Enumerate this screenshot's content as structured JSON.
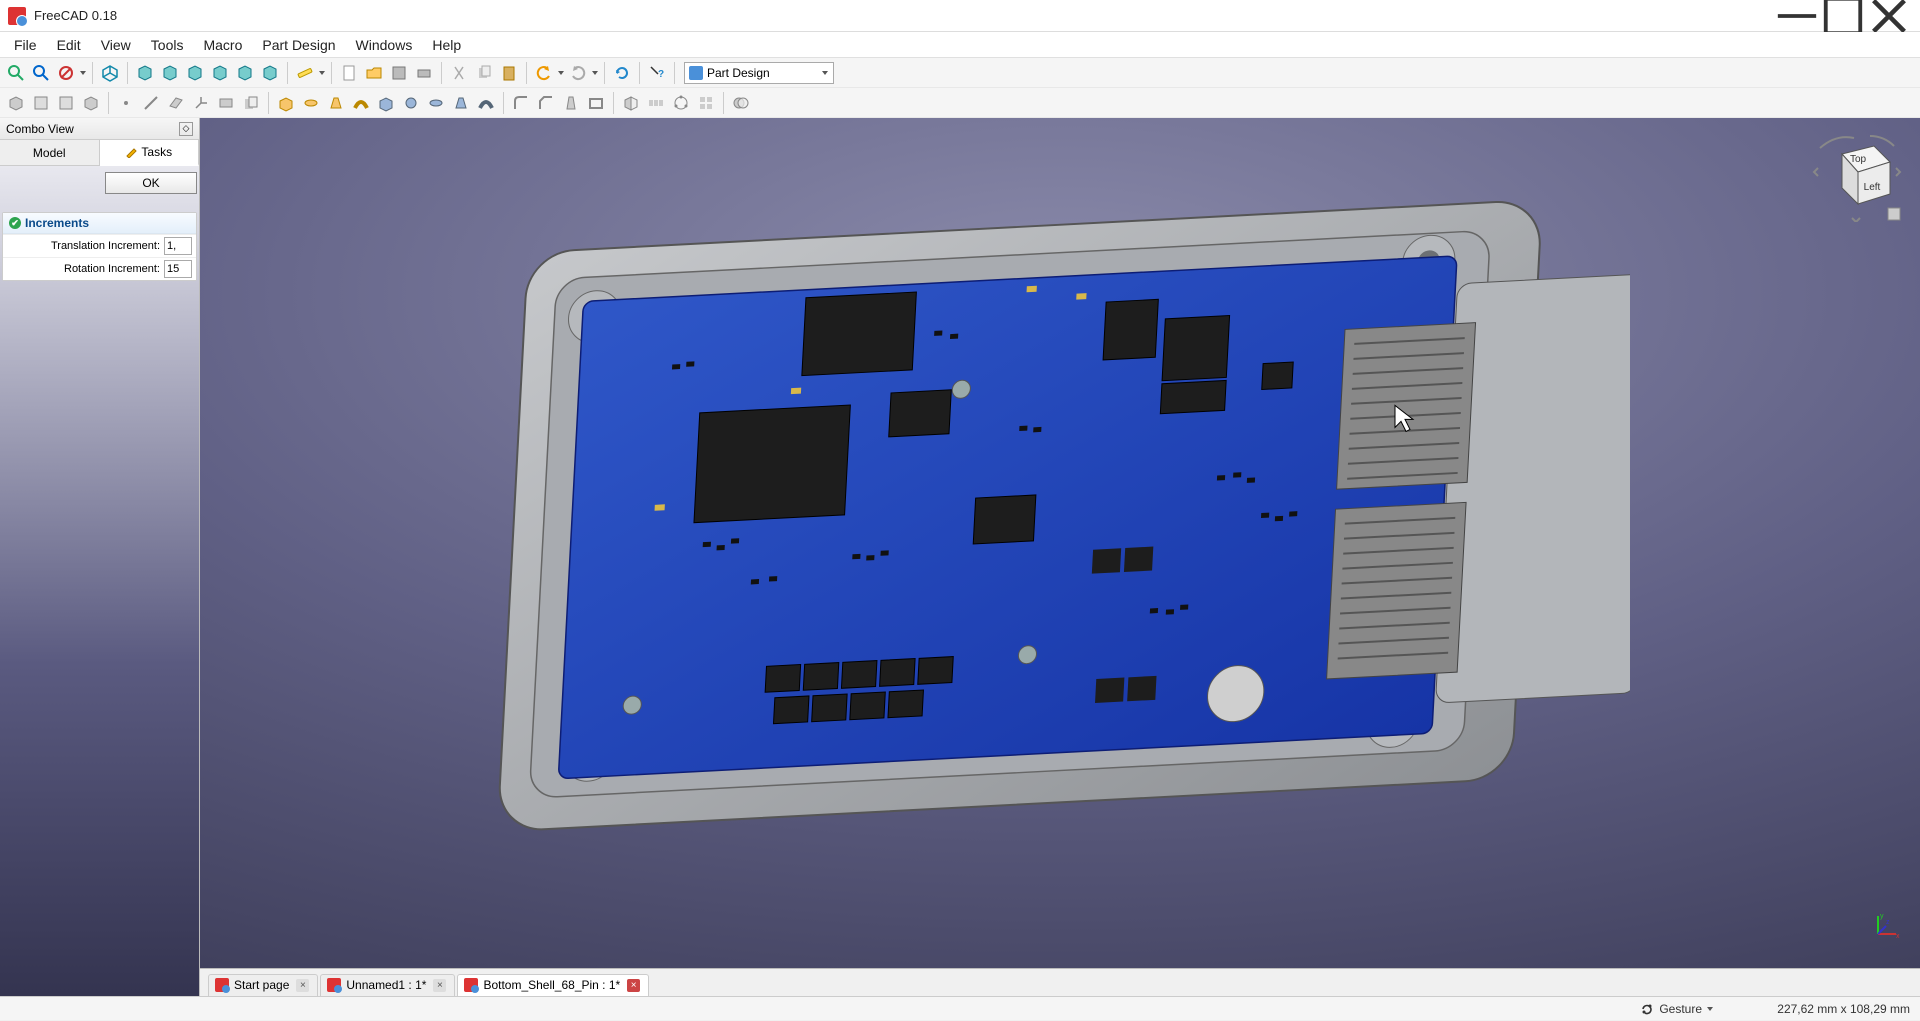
{
  "app": {
    "title": "FreeCAD 0.18"
  },
  "menu": [
    "File",
    "Edit",
    "View",
    "Tools",
    "Macro",
    "Part Design",
    "Windows",
    "Help"
  ],
  "workbench": {
    "label": "Part Design"
  },
  "combo": {
    "title": "Combo View",
    "tabs": {
      "model": "Model",
      "tasks": "Tasks"
    },
    "ok_label": "OK",
    "panel_title": "Increments",
    "translation_label": "Translation Increment:",
    "translation_value": "1,",
    "rotation_label": "Rotation Increment:",
    "rotation_value": "15"
  },
  "navcube": {
    "top": "Top",
    "left": "Left"
  },
  "doctabs": [
    {
      "label": "Start page",
      "active": false,
      "dirty": false,
      "close": "g"
    },
    {
      "label": "Unnamed1 : 1*",
      "active": false,
      "dirty": true,
      "close": "g"
    },
    {
      "label": "Bottom_Shell_68_Pin : 1*",
      "active": true,
      "dirty": true,
      "close": "r"
    }
  ],
  "status": {
    "nav_style": "Gesture",
    "dims": "227,62 mm x 108,29 mm"
  }
}
